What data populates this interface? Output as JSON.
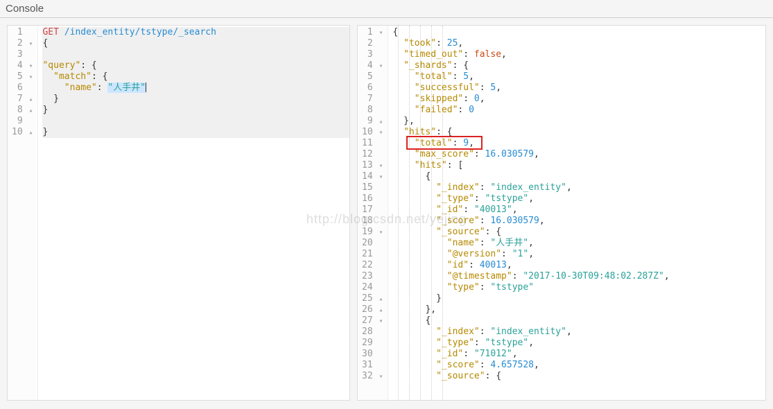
{
  "header": {
    "title": "Console"
  },
  "watermark": "http://blog.csdn.net/yejing",
  "left": {
    "lines": [
      {
        "n": "1",
        "fold": null
      },
      {
        "n": "2",
        "fold": "▾"
      },
      {
        "n": "3",
        "fold": null
      },
      {
        "n": "4",
        "fold": "▾"
      },
      {
        "n": "5",
        "fold": "▾"
      },
      {
        "n": "6",
        "fold": null
      },
      {
        "n": "7",
        "fold": "▴"
      },
      {
        "n": "8",
        "fold": "▴"
      },
      {
        "n": "9",
        "fold": null
      },
      {
        "n": "10",
        "fold": "▴"
      }
    ],
    "request": {
      "method": "GET",
      "url": "/index_entity/tstype/_search",
      "body_key_query": "\"query\"",
      "body_key_match": "\"match\"",
      "body_key_name": "\"name\"",
      "body_val_name": "\"人手井\""
    }
  },
  "right": {
    "lines": [
      {
        "n": "1",
        "fold": "▾"
      },
      {
        "n": "2",
        "fold": null
      },
      {
        "n": "3",
        "fold": null
      },
      {
        "n": "4",
        "fold": "▾"
      },
      {
        "n": "5",
        "fold": null
      },
      {
        "n": "6",
        "fold": null
      },
      {
        "n": "7",
        "fold": null
      },
      {
        "n": "8",
        "fold": null
      },
      {
        "n": "9",
        "fold": "▴"
      },
      {
        "n": "10",
        "fold": "▾"
      },
      {
        "n": "11",
        "fold": null
      },
      {
        "n": "12",
        "fold": null
      },
      {
        "n": "13",
        "fold": "▾"
      },
      {
        "n": "14",
        "fold": "▾"
      },
      {
        "n": "15",
        "fold": null
      },
      {
        "n": "16",
        "fold": null
      },
      {
        "n": "17",
        "fold": null
      },
      {
        "n": "18",
        "fold": null
      },
      {
        "n": "19",
        "fold": "▾"
      },
      {
        "n": "20",
        "fold": null
      },
      {
        "n": "21",
        "fold": null
      },
      {
        "n": "22",
        "fold": null
      },
      {
        "n": "23",
        "fold": null
      },
      {
        "n": "24",
        "fold": null
      },
      {
        "n": "25",
        "fold": "▴"
      },
      {
        "n": "26",
        "fold": "▴"
      },
      {
        "n": "27",
        "fold": "▾"
      },
      {
        "n": "28",
        "fold": null
      },
      {
        "n": "29",
        "fold": null
      },
      {
        "n": "30",
        "fold": null
      },
      {
        "n": "31",
        "fold": null
      },
      {
        "n": "32",
        "fold": "▾"
      }
    ],
    "response": {
      "took_key": "\"took\"",
      "took_val": "25",
      "timed_out_key": "\"timed_out\"",
      "timed_out_val": "false",
      "shards_key": "\"_shards\"",
      "shards_total_key": "\"total\"",
      "shards_total_val": "5",
      "shards_successful_key": "\"successful\"",
      "shards_successful_val": "5",
      "shards_skipped_key": "\"skipped\"",
      "shards_skipped_val": "0",
      "shards_failed_key": "\"failed\"",
      "shards_failed_val": "0",
      "hits_key": "\"hits\"",
      "hits_total_key": "\"total\"",
      "hits_total_val": "9",
      "max_score_key": "\"max_score\"",
      "max_score_val": "16.030579",
      "hits_arr_key": "\"hits\"",
      "hit0_index_key": "\"_index\"",
      "hit0_index_val": "\"index_entity\"",
      "hit0_type_key": "\"_type\"",
      "hit0_type_val": "\"tstype\"",
      "hit0_id_key": "\"_id\"",
      "hit0_id_val": "\"40013\"",
      "hit0_score_key": "\"_score\"",
      "hit0_score_val": "16.030579",
      "hit0_source_key": "\"_source\"",
      "hit0_name_key": "\"name\"",
      "hit0_name_val": "\"人手井\"",
      "hit0_version_key": "\"@version\"",
      "hit0_version_val": "\"1\"",
      "hit0_nid_key": "\"id\"",
      "hit0_nid_val": "40013",
      "hit0_ts_key": "\"@timestamp\"",
      "hit0_ts_val": "\"2017-10-30T09:48:02.287Z\"",
      "hit0_typef_key": "\"type\"",
      "hit0_typef_val": "\"tstype\"",
      "hit1_index_key": "\"_index\"",
      "hit1_index_val": "\"index_entity\"",
      "hit1_type_key": "\"_type\"",
      "hit1_type_val": "\"tstype\"",
      "hit1_id_key": "\"_id\"",
      "hit1_id_val": "\"71012\"",
      "hit1_score_key": "\"_score\"",
      "hit1_score_val": "4.657528",
      "hit1_source_key": "\"_source\""
    }
  }
}
